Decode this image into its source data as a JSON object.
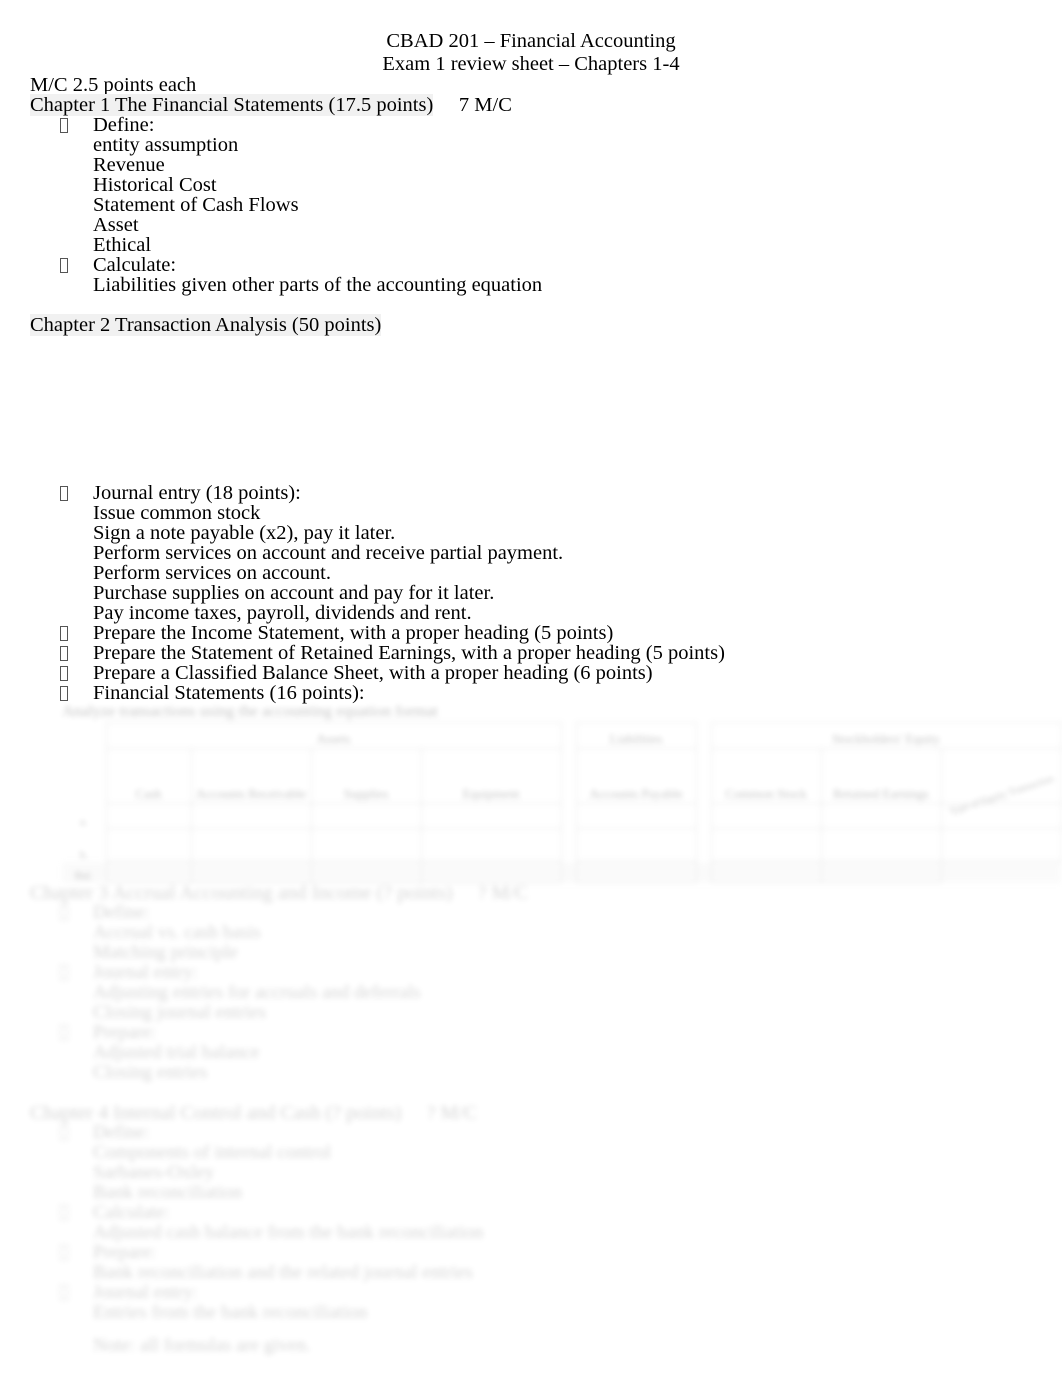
{
  "document": {
    "title": "CBAD 201 – Financial Accounting",
    "subtitle": "Exam 1 review sheet – Chapters 1-4",
    "intro": "M/C 2.5 points each"
  },
  "bullet_glyph": "❑",
  "chapter1": {
    "heading": "Chapter 1 The Financial Statements (17.5 points)",
    "mc_note": "7 M/C",
    "items": [
      {
        "label": "Define:",
        "sub": [
          "entity assumption",
          "Revenue",
          "Historical Cost",
          "Statement of Cash Flows",
          "Asset",
          "Ethical"
        ]
      },
      {
        "label": "Calculate:",
        "sub": [
          "Liabilities given other parts of the accounting equation"
        ]
      }
    ]
  },
  "chapter2": {
    "heading": "Chapter 2 Transaction Analysis (50 points)",
    "items": [
      {
        "label": "Journal entry (18 points):",
        "sub": [
          "Issue common stock",
          "Sign a note payable (x2), pay it later.",
          "Perform services on account and receive partial payment.",
          "Perform services on account.",
          "Purchase supplies on account and pay for it later.",
          "Pay income taxes, payroll, dividends and rent."
        ]
      },
      {
        "label": "Prepare the Income Statement, with a proper heading (5 points)",
        "sub": []
      },
      {
        "label": "Prepare the Statement of Retained Earnings, with a proper heading (5 points)",
        "sub": []
      },
      {
        "label": "Prepare a Classified Balance Sheet, with a proper heading (6 points)",
        "sub": []
      },
      {
        "label": "Financial Statements (16 points):",
        "sub": []
      }
    ]
  },
  "equation_table": {
    "caption": "Analyze transactions using the accounting equation format",
    "group_headers": [
      "Assets",
      "Liabilities",
      "Stockholders' Equity"
    ],
    "asset_columns": [
      "Cash",
      "Accounts Receivable",
      "Supplies",
      "Equipment"
    ],
    "liability_columns": [
      "Accounts Payable"
    ],
    "equity_columns": [
      "Common Stock",
      "Retained Earnings"
    ],
    "corner_label": "Type of Equity Transaction",
    "row_labels": [
      "a.",
      "b.",
      "Bal."
    ],
    "blank_rows": 3
  },
  "chapter3": {
    "heading": "Chapter 3 Accrual Accounting and Income (? points)",
    "mc_note": "? M/C",
    "items": [
      {
        "label": "Define:",
        "sub": [
          "Accrual vs. cash basis",
          "Matching principle"
        ]
      },
      {
        "label": "Journal entry:",
        "sub": [
          "Adjusting entries for accruals and deferrals",
          "Closing journal entries"
        ]
      },
      {
        "label": "Prepare:",
        "sub": [
          "Adjusted trial balance",
          "Closing entries"
        ]
      }
    ]
  },
  "chapter4": {
    "heading": "Chapter 4 Internal Control and Cash (? points)",
    "mc_note": "? M/C",
    "items": [
      {
        "label": "Define:",
        "sub": [
          "Components of internal control",
          "Sarbanes-Oxley",
          "Bank reconciliation"
        ]
      },
      {
        "label": "Calculate:",
        "sub": [
          "Adjusted cash balance from the bank reconciliation"
        ]
      },
      {
        "label": "Prepare:",
        "sub": [
          "Bank reconciliation and the related journal entries"
        ]
      },
      {
        "label": "Journal entry:",
        "sub": [
          "Entries from the bank reconciliation"
        ]
      },
      {
        "label": "Note: all formulas are given.",
        "sub": []
      }
    ]
  }
}
